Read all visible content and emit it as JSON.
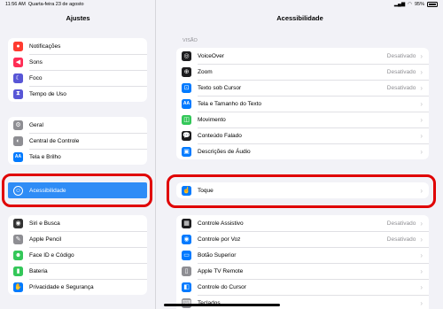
{
  "status": {
    "time": "11:56 AM",
    "date": "Quarta-feira 23 de agosto",
    "battery": "95%"
  },
  "sidebar": {
    "title": "Ajustes",
    "groups": [
      [
        {
          "label": "Notificações",
          "icon": "bell-icon",
          "color": "#ff3b30"
        },
        {
          "label": "Sons",
          "icon": "speaker-icon",
          "color": "#ff2d55"
        },
        {
          "label": "Foco",
          "icon": "moon-icon",
          "color": "#5856d6"
        },
        {
          "label": "Tempo de Uso",
          "icon": "hourglass-icon",
          "color": "#5856d6"
        }
      ],
      [
        {
          "label": "Geral",
          "icon": "gear-icon",
          "color": "#8e8e93"
        },
        {
          "label": "Central de Controle",
          "icon": "toggles-icon",
          "color": "#8e8e93"
        },
        {
          "label": "Tela e Brilho",
          "icon": "aa-icon",
          "color": "#007aff"
        },
        {
          "label": "Acessibilidade",
          "icon": "accessibility-icon",
          "color": "#2f8cf6",
          "selected": true
        }
      ],
      [
        {
          "label": "Siri e Busca",
          "icon": "siri-icon",
          "color": "#333333"
        },
        {
          "label": "Apple Pencil",
          "icon": "pencil-icon",
          "color": "#8e8e93"
        },
        {
          "label": "Face ID e Código",
          "icon": "faceid-icon",
          "color": "#34c759"
        },
        {
          "label": "Bateria",
          "icon": "battery-icon",
          "color": "#34c759"
        },
        {
          "label": "Privacidade e Segurança",
          "icon": "hand-icon",
          "color": "#007aff"
        }
      ]
    ]
  },
  "main": {
    "title": "Acessibilidade",
    "section_vision": "VISÃO",
    "vision": [
      {
        "label": "VoiceOver",
        "value": "Desativado",
        "icon": "voiceover-icon",
        "color": "#1c1c1e"
      },
      {
        "label": "Zoom",
        "value": "Desativado",
        "icon": "zoom-icon",
        "color": "#1c1c1e"
      },
      {
        "label": "Texto sob Cursor",
        "value": "Desativado",
        "icon": "hover-text-icon",
        "color": "#007aff"
      },
      {
        "label": "Tela e Tamanho do Texto",
        "value": "",
        "icon": "aa-icon",
        "color": "#007aff"
      },
      {
        "label": "Movimento",
        "value": "",
        "icon": "motion-icon",
        "color": "#34c759"
      },
      {
        "label": "Conteúdo Falado",
        "value": "",
        "icon": "speech-bubble-icon",
        "color": "#1c1c1e"
      },
      {
        "label": "Descrições de Áudio",
        "value": "",
        "icon": "audio-description-icon",
        "color": "#007aff"
      }
    ],
    "touch": [
      {
        "label": "Toque",
        "value": "",
        "icon": "touch-hand-icon",
        "color": "#007aff"
      }
    ],
    "motor": [
      {
        "label": "Controle Assistivo",
        "value": "Desativado",
        "icon": "switch-control-icon",
        "color": "#1c1c1e"
      },
      {
        "label": "Controle por Voz",
        "value": "Desativado",
        "icon": "voice-control-icon",
        "color": "#007aff"
      },
      {
        "label": "Botão Superior",
        "value": "",
        "icon": "top-button-icon",
        "color": "#007aff"
      },
      {
        "label": "Apple TV Remote",
        "value": "",
        "icon": "tv-remote-icon",
        "color": "#8e8e93"
      },
      {
        "label": "Controle do Cursor",
        "value": "",
        "icon": "cursor-icon",
        "color": "#007aff"
      },
      {
        "label": "Teclados",
        "value": "",
        "icon": "keyboard-icon",
        "color": "#8e8e93"
      }
    ]
  }
}
